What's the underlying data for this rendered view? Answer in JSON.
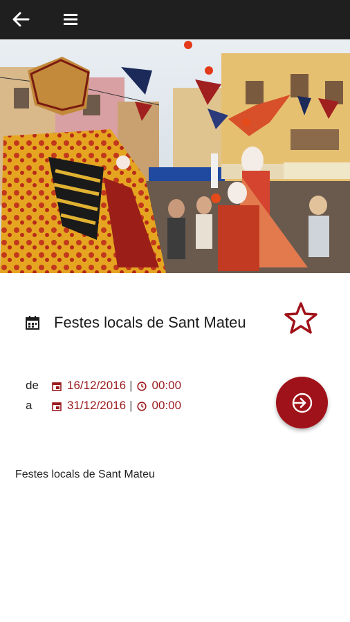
{
  "header": {
    "back_icon": "arrow-left-icon",
    "menu_icon": "hamburger-menu-icon"
  },
  "hero": {
    "image": "festival-street-performers-photo"
  },
  "event": {
    "title": "Festes locals de Sant Mateu",
    "favorite_icon": "star-outline-icon",
    "from": {
      "prefix": "de",
      "date": "16/12/2016",
      "time": "00:00"
    },
    "to": {
      "prefix": "a",
      "date": "31/12/2016",
      "time": "00:00"
    },
    "separator": "|",
    "description": "Festes locals de Sant Mateu"
  },
  "colors": {
    "accent": "#a01219",
    "app_bar": "#1f1f1f"
  }
}
